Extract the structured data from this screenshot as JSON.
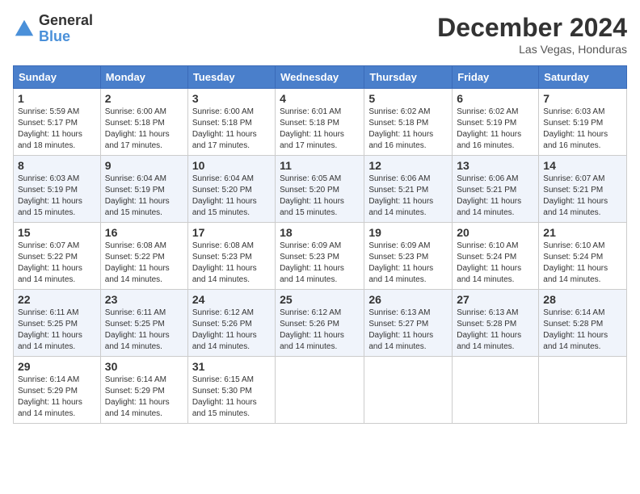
{
  "header": {
    "logo_general": "General",
    "logo_blue": "Blue",
    "month_title": "December 2024",
    "location": "Las Vegas, Honduras"
  },
  "weekdays": [
    "Sunday",
    "Monday",
    "Tuesday",
    "Wednesday",
    "Thursday",
    "Friday",
    "Saturday"
  ],
  "weeks": [
    [
      {
        "day": "1",
        "sunrise": "Sunrise: 5:59 AM",
        "sunset": "Sunset: 5:17 PM",
        "daylight": "Daylight: 11 hours and 18 minutes."
      },
      {
        "day": "2",
        "sunrise": "Sunrise: 6:00 AM",
        "sunset": "Sunset: 5:18 PM",
        "daylight": "Daylight: 11 hours and 17 minutes."
      },
      {
        "day": "3",
        "sunrise": "Sunrise: 6:00 AM",
        "sunset": "Sunset: 5:18 PM",
        "daylight": "Daylight: 11 hours and 17 minutes."
      },
      {
        "day": "4",
        "sunrise": "Sunrise: 6:01 AM",
        "sunset": "Sunset: 5:18 PM",
        "daylight": "Daylight: 11 hours and 17 minutes."
      },
      {
        "day": "5",
        "sunrise": "Sunrise: 6:02 AM",
        "sunset": "Sunset: 5:18 PM",
        "daylight": "Daylight: 11 hours and 16 minutes."
      },
      {
        "day": "6",
        "sunrise": "Sunrise: 6:02 AM",
        "sunset": "Sunset: 5:19 PM",
        "daylight": "Daylight: 11 hours and 16 minutes."
      },
      {
        "day": "7",
        "sunrise": "Sunrise: 6:03 AM",
        "sunset": "Sunset: 5:19 PM",
        "daylight": "Daylight: 11 hours and 16 minutes."
      }
    ],
    [
      {
        "day": "8",
        "sunrise": "Sunrise: 6:03 AM",
        "sunset": "Sunset: 5:19 PM",
        "daylight": "Daylight: 11 hours and 15 minutes."
      },
      {
        "day": "9",
        "sunrise": "Sunrise: 6:04 AM",
        "sunset": "Sunset: 5:19 PM",
        "daylight": "Daylight: 11 hours and 15 minutes."
      },
      {
        "day": "10",
        "sunrise": "Sunrise: 6:04 AM",
        "sunset": "Sunset: 5:20 PM",
        "daylight": "Daylight: 11 hours and 15 minutes."
      },
      {
        "day": "11",
        "sunrise": "Sunrise: 6:05 AM",
        "sunset": "Sunset: 5:20 PM",
        "daylight": "Daylight: 11 hours and 15 minutes."
      },
      {
        "day": "12",
        "sunrise": "Sunrise: 6:06 AM",
        "sunset": "Sunset: 5:21 PM",
        "daylight": "Daylight: 11 hours and 14 minutes."
      },
      {
        "day": "13",
        "sunrise": "Sunrise: 6:06 AM",
        "sunset": "Sunset: 5:21 PM",
        "daylight": "Daylight: 11 hours and 14 minutes."
      },
      {
        "day": "14",
        "sunrise": "Sunrise: 6:07 AM",
        "sunset": "Sunset: 5:21 PM",
        "daylight": "Daylight: 11 hours and 14 minutes."
      }
    ],
    [
      {
        "day": "15",
        "sunrise": "Sunrise: 6:07 AM",
        "sunset": "Sunset: 5:22 PM",
        "daylight": "Daylight: 11 hours and 14 minutes."
      },
      {
        "day": "16",
        "sunrise": "Sunrise: 6:08 AM",
        "sunset": "Sunset: 5:22 PM",
        "daylight": "Daylight: 11 hours and 14 minutes."
      },
      {
        "day": "17",
        "sunrise": "Sunrise: 6:08 AM",
        "sunset": "Sunset: 5:23 PM",
        "daylight": "Daylight: 11 hours and 14 minutes."
      },
      {
        "day": "18",
        "sunrise": "Sunrise: 6:09 AM",
        "sunset": "Sunset: 5:23 PM",
        "daylight": "Daylight: 11 hours and 14 minutes."
      },
      {
        "day": "19",
        "sunrise": "Sunrise: 6:09 AM",
        "sunset": "Sunset: 5:23 PM",
        "daylight": "Daylight: 11 hours and 14 minutes."
      },
      {
        "day": "20",
        "sunrise": "Sunrise: 6:10 AM",
        "sunset": "Sunset: 5:24 PM",
        "daylight": "Daylight: 11 hours and 14 minutes."
      },
      {
        "day": "21",
        "sunrise": "Sunrise: 6:10 AM",
        "sunset": "Sunset: 5:24 PM",
        "daylight": "Daylight: 11 hours and 14 minutes."
      }
    ],
    [
      {
        "day": "22",
        "sunrise": "Sunrise: 6:11 AM",
        "sunset": "Sunset: 5:25 PM",
        "daylight": "Daylight: 11 hours and 14 minutes."
      },
      {
        "day": "23",
        "sunrise": "Sunrise: 6:11 AM",
        "sunset": "Sunset: 5:25 PM",
        "daylight": "Daylight: 11 hours and 14 minutes."
      },
      {
        "day": "24",
        "sunrise": "Sunrise: 6:12 AM",
        "sunset": "Sunset: 5:26 PM",
        "daylight": "Daylight: 11 hours and 14 minutes."
      },
      {
        "day": "25",
        "sunrise": "Sunrise: 6:12 AM",
        "sunset": "Sunset: 5:26 PM",
        "daylight": "Daylight: 11 hours and 14 minutes."
      },
      {
        "day": "26",
        "sunrise": "Sunrise: 6:13 AM",
        "sunset": "Sunset: 5:27 PM",
        "daylight": "Daylight: 11 hours and 14 minutes."
      },
      {
        "day": "27",
        "sunrise": "Sunrise: 6:13 AM",
        "sunset": "Sunset: 5:28 PM",
        "daylight": "Daylight: 11 hours and 14 minutes."
      },
      {
        "day": "28",
        "sunrise": "Sunrise: 6:14 AM",
        "sunset": "Sunset: 5:28 PM",
        "daylight": "Daylight: 11 hours and 14 minutes."
      }
    ],
    [
      {
        "day": "29",
        "sunrise": "Sunrise: 6:14 AM",
        "sunset": "Sunset: 5:29 PM",
        "daylight": "Daylight: 11 hours and 14 minutes."
      },
      {
        "day": "30",
        "sunrise": "Sunrise: 6:14 AM",
        "sunset": "Sunset: 5:29 PM",
        "daylight": "Daylight: 11 hours and 14 minutes."
      },
      {
        "day": "31",
        "sunrise": "Sunrise: 6:15 AM",
        "sunset": "Sunset: 5:30 PM",
        "daylight": "Daylight: 11 hours and 15 minutes."
      },
      null,
      null,
      null,
      null
    ]
  ]
}
